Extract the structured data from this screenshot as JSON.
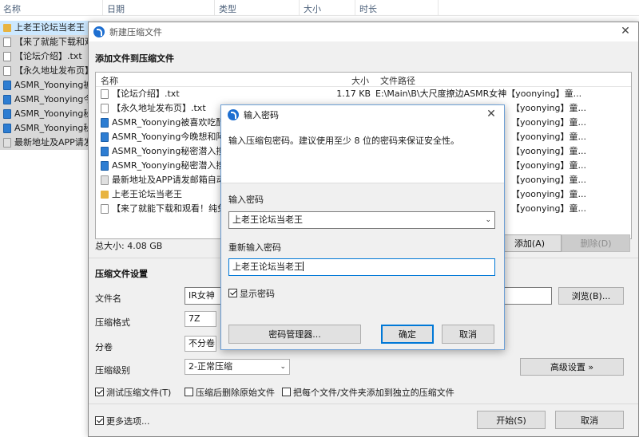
{
  "explorer": {
    "columns": [
      "名称",
      "日期",
      "类型",
      "大小",
      "时长"
    ],
    "items": [
      {
        "label": "上老王论坛当老王",
        "icon": "folder-icon"
      },
      {
        "label": "【来了就能下载和观",
        "icon": "txt-file-icon"
      },
      {
        "label": "【论坛介绍】.txt",
        "icon": "txt-file-icon"
      },
      {
        "label": "【永久地址发布页】",
        "icon": "txt-file-icon"
      },
      {
        "label": "ASMR_Yoonying被",
        "icon": "media-file-icon"
      },
      {
        "label": "ASMR_Yoonying今",
        "icon": "media-file-icon"
      },
      {
        "label": "ASMR_Yoonying秘",
        "icon": "media-file-icon"
      },
      {
        "label": "ASMR_Yoonying秘",
        "icon": "media-file-icon"
      },
      {
        "label": "最新地址及APP请发",
        "icon": "shortcut-icon"
      }
    ]
  },
  "main_dialog": {
    "title": "新建压缩文件",
    "add_files_heading": "添加文件到压缩文件",
    "list_headers": {
      "name": "名称",
      "size": "大小",
      "path": "文件路径"
    },
    "files": [
      {
        "name": "【论坛介绍】.txt",
        "size": "1.17 KB",
        "path": "E:\\Main\\B\\大尺度撩边ASMR女神【yoonying】童...",
        "icon": "txt-file-icon"
      },
      {
        "name": "【永久地址发布页】.txt",
        "size": "",
        "path": "【yoonying】童...",
        "icon": "txt-file-icon"
      },
      {
        "name": "ASMR_Yoonying被喜欢吃醋的",
        "size": "",
        "path": "【yoonying】童...",
        "icon": "media-file-icon"
      },
      {
        "name": "ASMR_Yoonying今晚想和阿狸",
        "size": "",
        "path": "【yoonying】童...",
        "icon": "media-file-icon"
      },
      {
        "name": "ASMR_Yoonying秘密潜入搜查",
        "size": "",
        "path": "【yoonying】童...",
        "icon": "media-file-icon"
      },
      {
        "name": "ASMR_Yoonying秘密潜入搜查",
        "size": "",
        "path": "【yoonying】童...",
        "icon": "media-file-icon"
      },
      {
        "name": "最新地址及APP请发邮箱自动获",
        "size": "",
        "path": "【yoonying】童...",
        "icon": "shortcut-icon"
      },
      {
        "name": "上老王论坛当老王",
        "size": "",
        "path": "【yoonying】童...",
        "icon": "folder-icon"
      },
      {
        "name": "【来了就能下载和观看！纯免费",
        "size": "",
        "path": "【yoonying】童...",
        "icon": "txt-file-icon"
      }
    ],
    "total_size": "总大小: 4.08 GB",
    "add_button": "添加(A)",
    "delete_button": "删除(D)",
    "settings_heading": "压缩文件设置",
    "filename_label": "文件名",
    "filename_value": "IR女神【",
    "browse_button": "浏览(B)...",
    "format_label": "压缩格式",
    "format_value": "7Z",
    "split_label": "分卷",
    "split_value": "不分卷",
    "level_label": "压缩级别",
    "level_value": "2-正常压缩",
    "advanced_button": "高级设置 »",
    "test_check": "测试压缩文件(T)",
    "delete_after_check": "压缩后删除原始文件",
    "separate_check": "把每个文件/文件夹添加到独立的压缩文件",
    "more_options": "更多选项...",
    "start_button": "开始(S)",
    "cancel_button": "取消"
  },
  "password_dialog": {
    "title": "输入密码",
    "description": "输入压缩包密码。建议使用至少 8 位的密码来保证安全性。",
    "enter_label": "输入密码",
    "enter_value": "上老王论坛当老王",
    "reenter_label": "重新输入密码",
    "reenter_value": "上老王论坛当老王",
    "show_password": "显示密码",
    "manager_button": "密码管理器...",
    "ok_button": "确定",
    "cancel_button": "取消"
  }
}
